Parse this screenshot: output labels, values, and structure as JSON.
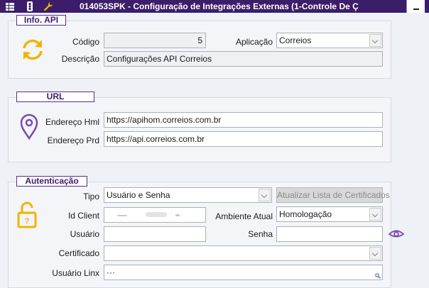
{
  "window": {
    "title": "014053SPK - Configuração de Integrações Externas (1-Controle De Ç"
  },
  "info_api": {
    "legend": "Info. API",
    "codigo_label": "Código",
    "codigo_value": "5",
    "aplicacao_label": "Aplicação",
    "aplicacao_value": "Correios",
    "descricao_label": "Descrição",
    "descricao_value": "Configurações API Correios"
  },
  "url": {
    "legend": "URL",
    "hml_label": "Endereço Hml",
    "hml_value": "https://apihom.correios.com.br",
    "prd_label": "Endereço Prd",
    "prd_value": "https://api.correios.com.br"
  },
  "autenticacao": {
    "legend": "Autenticação",
    "tipo_label": "Tipo",
    "tipo_value": "Usuário e Senha",
    "atualizar_button": "Atualizar Lista de Certificados",
    "id_client_label": "Id Client",
    "ambiente_label": "Ambiente Atual",
    "ambiente_value": "Homologação",
    "usuario_label": "Usuário",
    "senha_label": "Senha",
    "certificado_label": "Certificado",
    "usuario_linx_label": "Usuário Linx",
    "usuario_linx_value": "···"
  },
  "colors": {
    "title_bar": "#3b1d69",
    "accent": "#5b2c8f",
    "sync_icon": "#f0b400",
    "eye_icon": "#7b4bb0"
  }
}
